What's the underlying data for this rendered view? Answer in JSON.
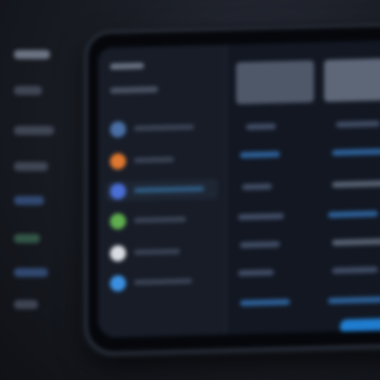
{
  "theme": {
    "background": "#1a1d25",
    "screen": "#121722",
    "sidebar": "#171c27",
    "accent_blue": "#1f7ccf"
  },
  "sidebar": {
    "items": [
      {
        "icon": "gear-icon",
        "color": "#4a6fa5"
      },
      {
        "icon": "circle-icon-orange",
        "color": "#e0782f"
      },
      {
        "icon": "circle-icon-blue",
        "color": "#4a6fd6"
      },
      {
        "icon": "circle-icon-green",
        "color": "#5fae4f"
      },
      {
        "icon": "circle-icon-white",
        "color": "#d9dde3"
      },
      {
        "icon": "circle-icon-lightblue",
        "color": "#3c8fe0"
      }
    ]
  },
  "main": {
    "columns": 2
  }
}
